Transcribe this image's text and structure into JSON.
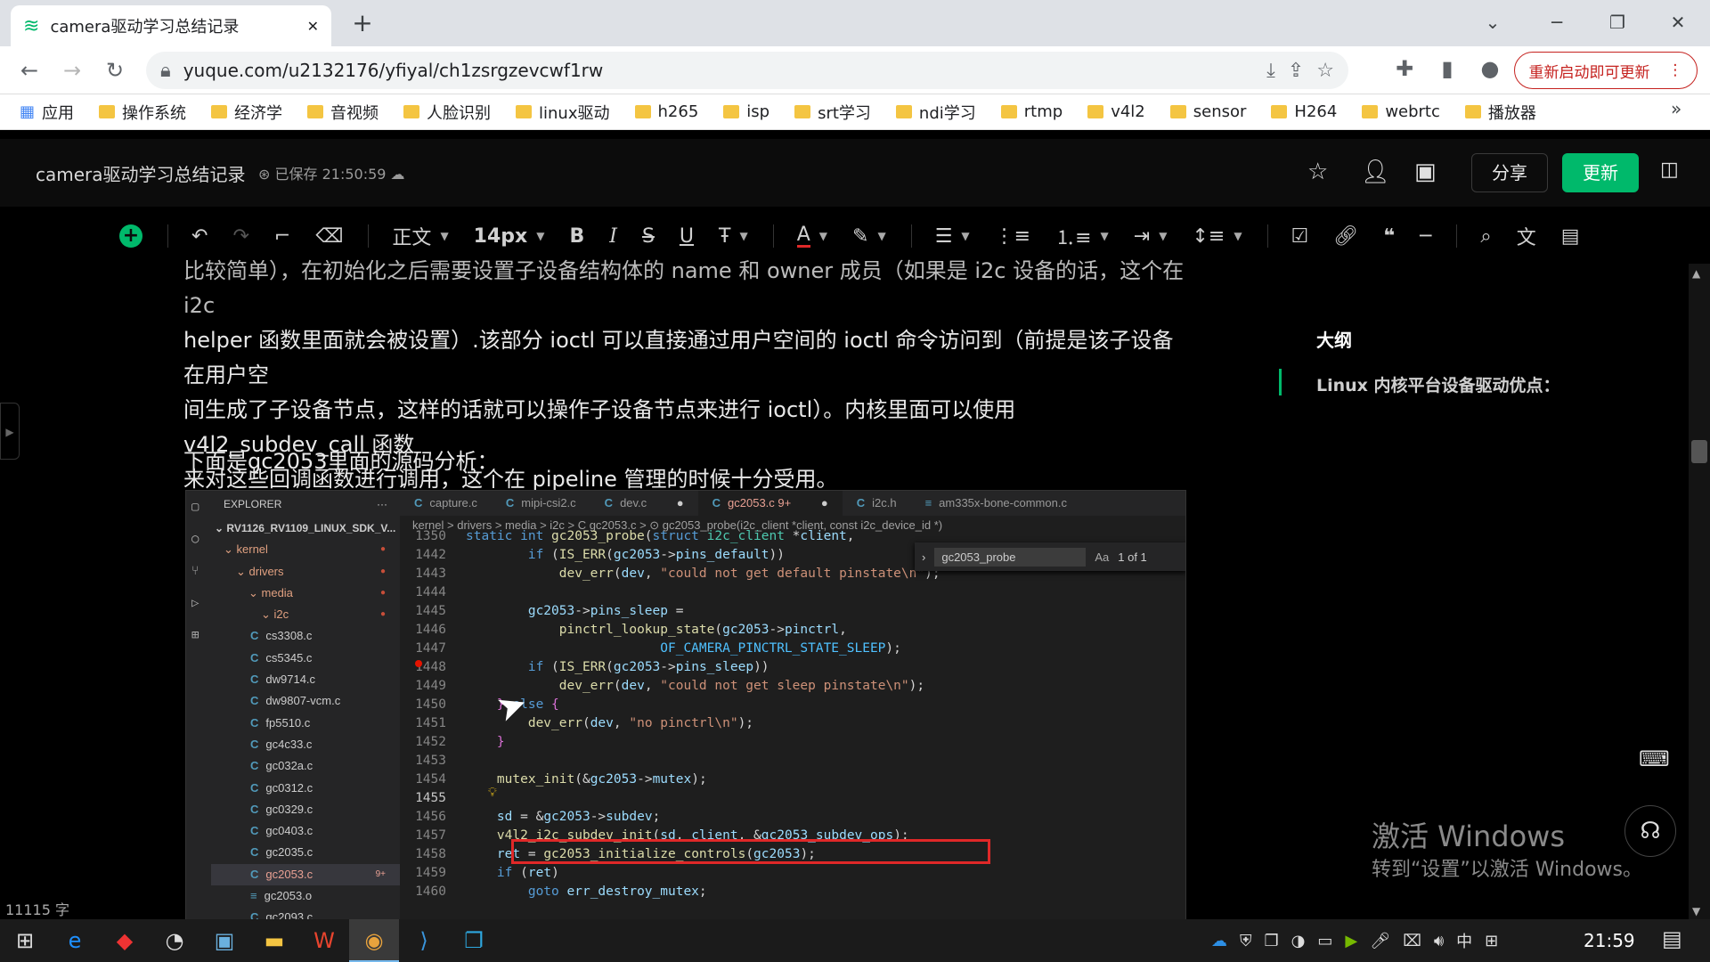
{
  "browser": {
    "tab_title": "camera驱动学习总结记录",
    "tab_close": "✕",
    "new_tab": "+",
    "url": "yuque.com/u2132176/yfiyal/ch1zsrgzevcwf1rw",
    "restart_label": "重新启动即可更新",
    "bookmarks": [
      "应用",
      "操作系统",
      "经济学",
      "音视频",
      "人脸识别",
      "linux驱动",
      "h265",
      "isp",
      "srt学习",
      "ndi学习",
      "rtmp",
      "v4l2",
      "sensor",
      "H264",
      "webrtc",
      "播放器"
    ],
    "bookmarks_more": "»"
  },
  "app": {
    "doc_title": "camera驱动学习总结记录",
    "saved_status": "已保存 21:50:59",
    "share_label": "分享",
    "update_label": "更新"
  },
  "toolbar": {
    "style_label": "正文",
    "font_size": "14px",
    "bold": "B",
    "italic": "I",
    "strike": "S",
    "underline": "U",
    "font_color": "A"
  },
  "content": {
    "line1": "比较简单），在初始化之后需要设置子设备结构体的 name 和 owner 成员（如果是 i2c 设备的话，这个在 i2c",
    "line2": "helper 函数里面就会被设置）.该部分 ioctl 可以直接通过用户空间的 ioctl 命令访问到（前提是该子设备在用户空",
    "line3": "间生成了子设备节点，这样的话就可以操作子设备节点来进行 ioctl）。内核里面可以使用 v4l2_subdev_call 函数",
    "line4": "来对这些回调函数进行调用，这个在 pipeline 管理的时候十分受用。",
    "heading": "下面是gc2053里面的源码分析："
  },
  "word_count": "11115 字",
  "outline": {
    "title": "大纲",
    "item": "Linux 内核平台设备驱动优点："
  },
  "watermark": {
    "line1": "激活 Windows",
    "line2": "转到“设置”以激活 Windows。"
  },
  "vscode": {
    "explorer_label": "EXPLORER",
    "workspace": "RV1126_RV1109_LINUX_SDK_V...",
    "tree": [
      {
        "name": "kernel",
        "dot": true
      },
      {
        "name": "drivers",
        "dot": true
      },
      {
        "name": "media",
        "dot": true
      },
      {
        "name": "i2c",
        "dot": true
      }
    ],
    "files": [
      "cs3308.c",
      "cs5345.c",
      "dw9714.c",
      "dw9807-vcm.c",
      "fp5510.c",
      "gc4c33.c",
      "gc032a.c",
      "gc0312.c",
      "gc0329.c",
      "gc0403.c",
      "gc2035.c",
      "gc2053.c",
      "gc2053.o",
      "gc2093.c"
    ],
    "selected_badge": "9+",
    "tabs": [
      "capture.c",
      "mipi-csi2.c",
      "dev.c",
      "gc2053.c 9+",
      "i2c.h",
      "am335x-bone-common.c"
    ],
    "breadcrumb": "kernel > drivers > media > i2c > C gc2053.c > ⊙ gc2053_probe(i2c_client *client, const i2c_device_id *)",
    "find_text": "gc2053_probe",
    "find_count": "1 of 1",
    "line_numbers": [
      "1350",
      "1442",
      "1443",
      "1444",
      "1445",
      "1446",
      "1447",
      "1448",
      "1449",
      "1450",
      "1451",
      "1452",
      "1453",
      "1454",
      "1455",
      "1456",
      "1457",
      "1458",
      "1459",
      "1460"
    ]
  },
  "taskbar": {
    "clock": "21:59",
    "ime": "中"
  }
}
